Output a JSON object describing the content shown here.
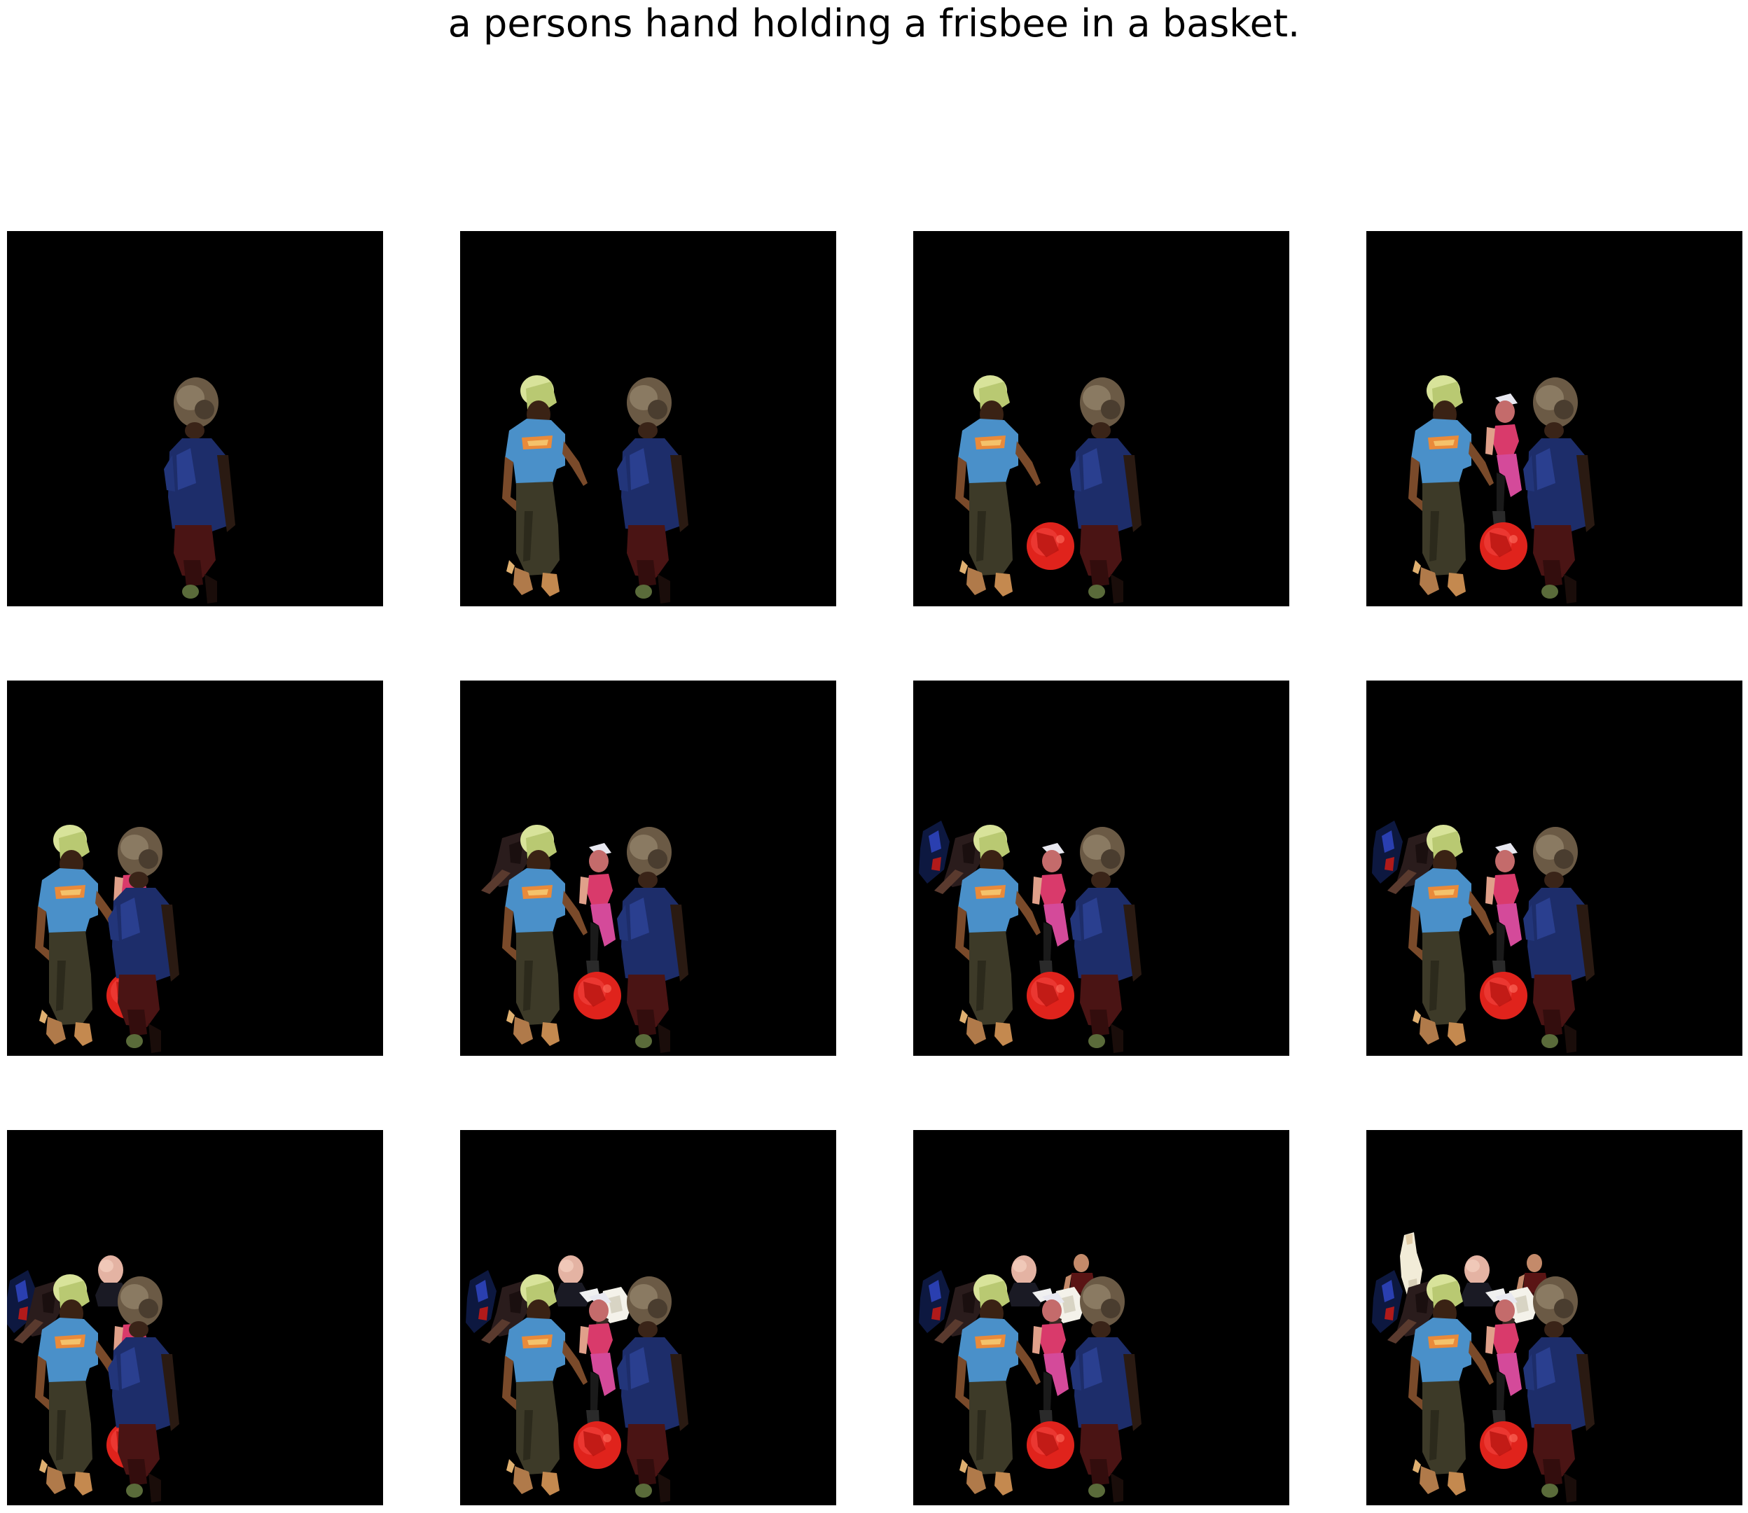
{
  "caption": "a persons hand holding a frisbee in a basket.",
  "colors": {
    "background": "#ffffff",
    "panel": "#000000"
  },
  "grid": {
    "rows": 3,
    "cols": 4
  },
  "panels": [
    {
      "step": 1,
      "objects": [
        "boy"
      ]
    },
    {
      "step": 2,
      "objects": [
        "boy",
        "woman"
      ]
    },
    {
      "step": 3,
      "objects": [
        "boy",
        "woman",
        "ball"
      ]
    },
    {
      "step": 4,
      "objects": [
        "boy",
        "woman",
        "ball",
        "girl"
      ]
    },
    {
      "step": 5,
      "objects": [
        "boy",
        "woman",
        "ball",
        "girl"
      ]
    },
    {
      "step": 6,
      "objects": [
        "boy",
        "woman",
        "ball",
        "girl",
        "dark-figure"
      ]
    },
    {
      "step": 7,
      "objects": [
        "boy",
        "woman",
        "ball",
        "girl",
        "dark-figure",
        "blue-figure"
      ]
    },
    {
      "step": 8,
      "objects": [
        "boy",
        "woman",
        "ball",
        "girl",
        "dark-figure",
        "blue-figure"
      ]
    },
    {
      "step": 9,
      "objects": [
        "boy",
        "woman",
        "ball",
        "girl",
        "dark-figure",
        "blue-figure",
        "bald-man"
      ]
    },
    {
      "step": 10,
      "objects": [
        "boy",
        "woman",
        "ball",
        "girl",
        "dark-figure",
        "blue-figure",
        "bald-man",
        "white-blob"
      ]
    },
    {
      "step": 11,
      "objects": [
        "boy",
        "woman",
        "ball",
        "girl",
        "dark-figure",
        "blue-figure",
        "bald-man",
        "white-blob",
        "maroon-man"
      ]
    },
    {
      "step": 12,
      "objects": [
        "boy",
        "woman",
        "ball",
        "girl",
        "dark-figure",
        "blue-figure",
        "bald-man",
        "white-blob",
        "maroon-man",
        "white-figure"
      ]
    }
  ]
}
